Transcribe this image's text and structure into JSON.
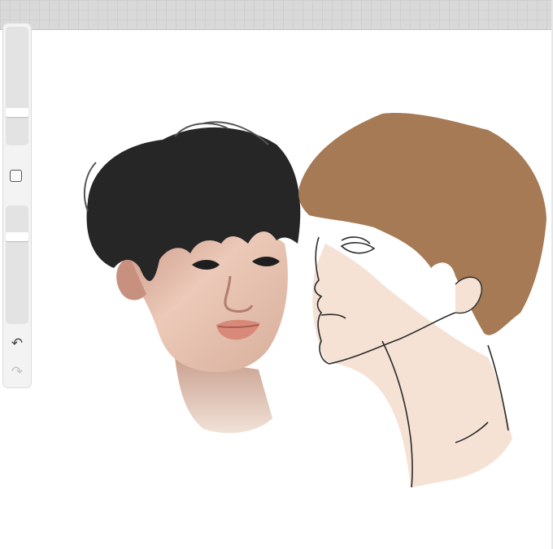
{
  "app": {
    "undo_icon": "undo-icon",
    "redo_icon": "redo-icon",
    "redo_enabled": false
  },
  "sidebar": {
    "brush_size_level": 0.71,
    "brush_opacity_level": 0.25
  },
  "colors": {
    "toolbar_bg": "#d9d9d9",
    "canvas_bg": "#ffffff",
    "dark_hair": "#262626",
    "brown_hair": "#a57a55",
    "skin_painted": "#e8c1ad",
    "skin_flat": "#f5e2d5",
    "lips": "#d9897a"
  }
}
